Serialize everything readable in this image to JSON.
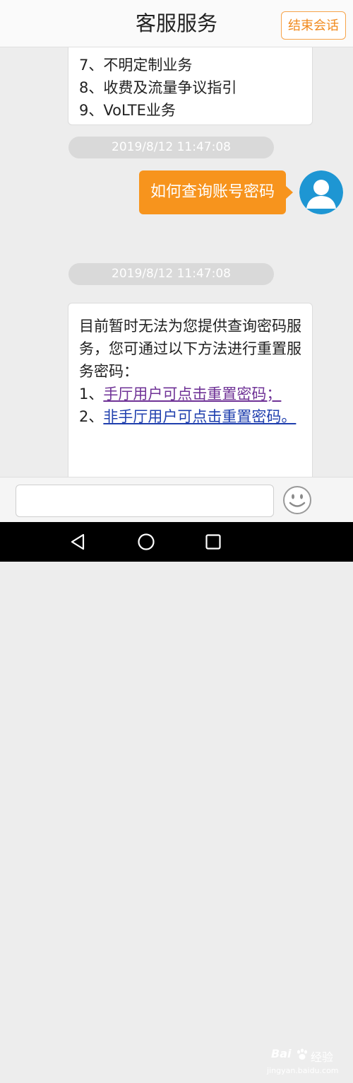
{
  "header": {
    "title": "客服服务",
    "end_button": "结束会话"
  },
  "chat": {
    "prev_menu": {
      "items": [
        "7、不明定制业务",
        "8、收费及流量争议指引",
        "9、VoLTE业务"
      ]
    },
    "timestamp_1": "2019/8/12 11:47:08",
    "user_message": "如何查询账号密码",
    "timestamp_2": "2019/8/12 11:47:08",
    "reply": {
      "text": "目前暂时无法为您提供查询密码服务，您可通过以下方法进行重置服务密码：",
      "link1_prefix": "1、",
      "link1_text": "手厅用户可点击重置密码；",
      "link2_prefix": "2、",
      "link2_text": "非手厅用户可点击重置密码。"
    }
  },
  "input": {
    "value": "",
    "emoji_icon": "smiley-face-icon"
  },
  "nav": {
    "icons": [
      "back-triangle-icon",
      "home-circle-icon",
      "recent-square-icon"
    ]
  },
  "watermark": {
    "logo": "Bai 经验",
    "logo_text": "Bai",
    "suffix": "经验",
    "url": "jingyan.baidu.com"
  },
  "colors": {
    "accent": "#f7941d",
    "link_primary": "#6f3296",
    "link_secondary": "#1f3fae"
  }
}
